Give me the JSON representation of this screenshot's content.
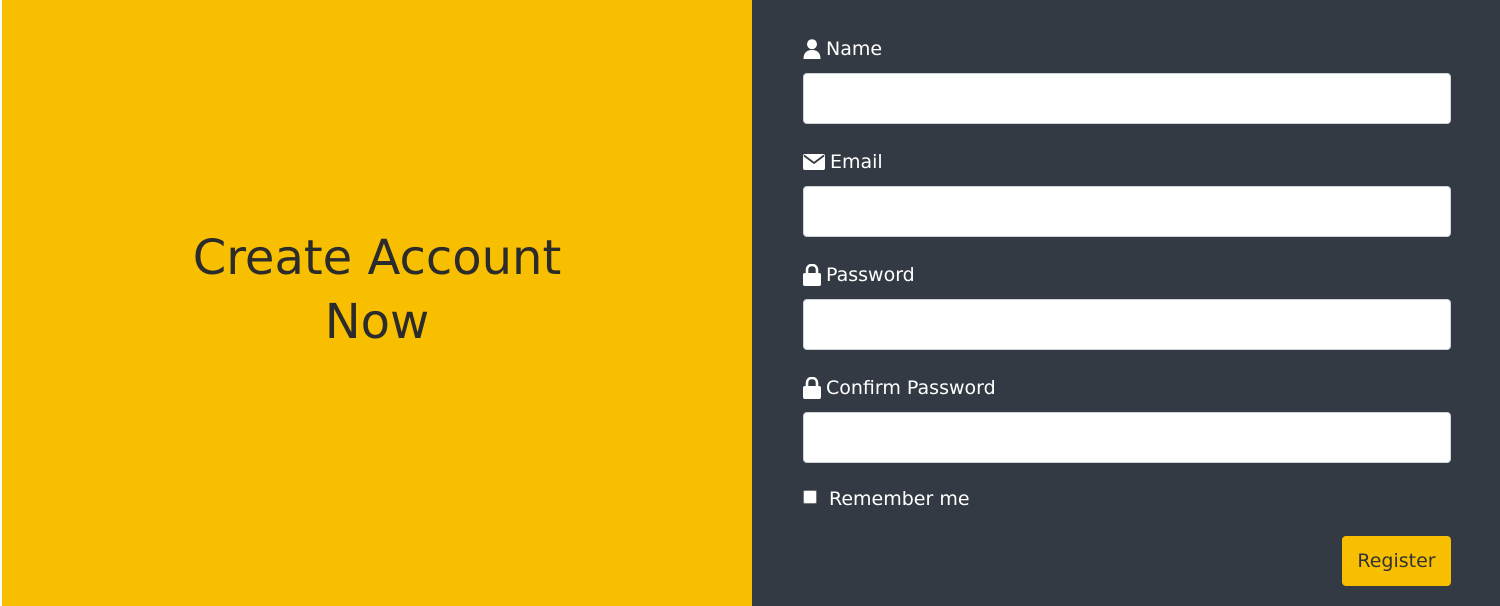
{
  "hero": {
    "title": "Create Account Now"
  },
  "form": {
    "name_label": "Name",
    "name_value": "",
    "email_label": "Email",
    "email_value": "",
    "password_label": "Password",
    "password_value": "",
    "confirm_password_label": "Confirm Password",
    "confirm_password_value": "",
    "remember_label": "Remember me",
    "remember_checked": false,
    "register_label": "Register"
  },
  "colors": {
    "accent": "#f8bf00",
    "panel_dark": "#343a43",
    "text_dark": "#2b2b2b",
    "text_light": "#ffffff"
  },
  "icons": {
    "name": "user-icon",
    "email": "envelope-icon",
    "password": "lock-icon",
    "confirm_password": "lock-icon"
  }
}
